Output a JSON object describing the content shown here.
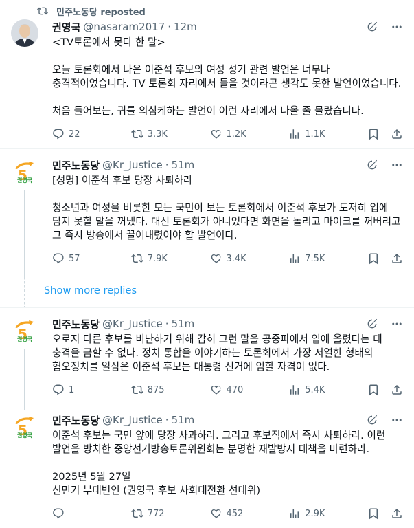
{
  "repost": {
    "label": "민주노동당 reposted"
  },
  "tweets": [
    {
      "name": "권영국",
      "handle": "@nasaram2017",
      "time": "12m",
      "text": "<TV토론에서 못다 한 말>\n\n오늘 토론회에서 나온 이준석 후보의 여성 성기 관련 발언은 너무나 충격적이었습니다. TV 토론회 자리에서 들을 것이라곤 생각도 못한 발언이었습니다.\n\n처음 들어보는, 귀를 의심케하는 발언이 이런 자리에서 나올 줄 몰랐습니다.",
      "replies": "22",
      "reposts": "3.3K",
      "likes": "1.2K",
      "views": "1.1K"
    },
    {
      "name": "민주노동당",
      "handle": "@Kr_Justice",
      "time": "51m",
      "text": "[성명] 이준석 후보 당장 사퇴하라\n\n청소년과 여성을 비롯한 모든 국민이 보는 토론회에서 이준석 후보가 도저히 입에 담지 못할 말을 꺼냈다. 대선 토론회가 아니었다면 화면을 돌리고 마이크를 꺼버리고 그 즉시 방송에서 끌어내렸어야 할 발언이다.",
      "replies": "57",
      "reposts": "7.9K",
      "likes": "3.4K",
      "views": "7.5K"
    },
    {
      "name": "민주노동당",
      "handle": "@Kr_Justice",
      "time": "51m",
      "text": "오로지 다른 후보를 비난하기 위해 감히 그런 말을 공중파에서 입에 올렸다는 데 충격을 금할 수 없다. 정치 통합을 이야기하는 토론회에서 가장 저열한 형태의 혐오정치를 일삼은 이준석 후보는 대통령 선거에 임할 자격이 없다.",
      "replies": "1",
      "reposts": "875",
      "likes": "470",
      "views": "5.4K"
    },
    {
      "name": "민주노동당",
      "handle": "@Kr_Justice",
      "time": "51m",
      "text": "이준석 후보는 국민 앞에 당장 사과하라. 그리고 후보직에서 즉시 사퇴하라. 이런 발언을 방치한 중앙선거방송토론위원회는 분명한 재발방지 대책을 마련하라.\n\n2025년 5월 27일\n신민기 부대변인 (권영국 후보 사회대전환 선대위)",
      "replies": "",
      "reposts": "772",
      "likes": "452",
      "views": "2.9K"
    }
  ],
  "show_more": "Show more replies",
  "logo": {
    "number": "5",
    "label": "권영국"
  },
  "colors": {
    "accent": "#1d9bf0",
    "muted": "#536471",
    "logo_orange": "#f5a623",
    "logo_green": "#2e9e3e"
  },
  "icons": [
    "repost-icon",
    "grok-icon",
    "more-icon",
    "reply-icon",
    "like-icon",
    "views-icon",
    "bookmark-icon",
    "share-icon"
  ]
}
